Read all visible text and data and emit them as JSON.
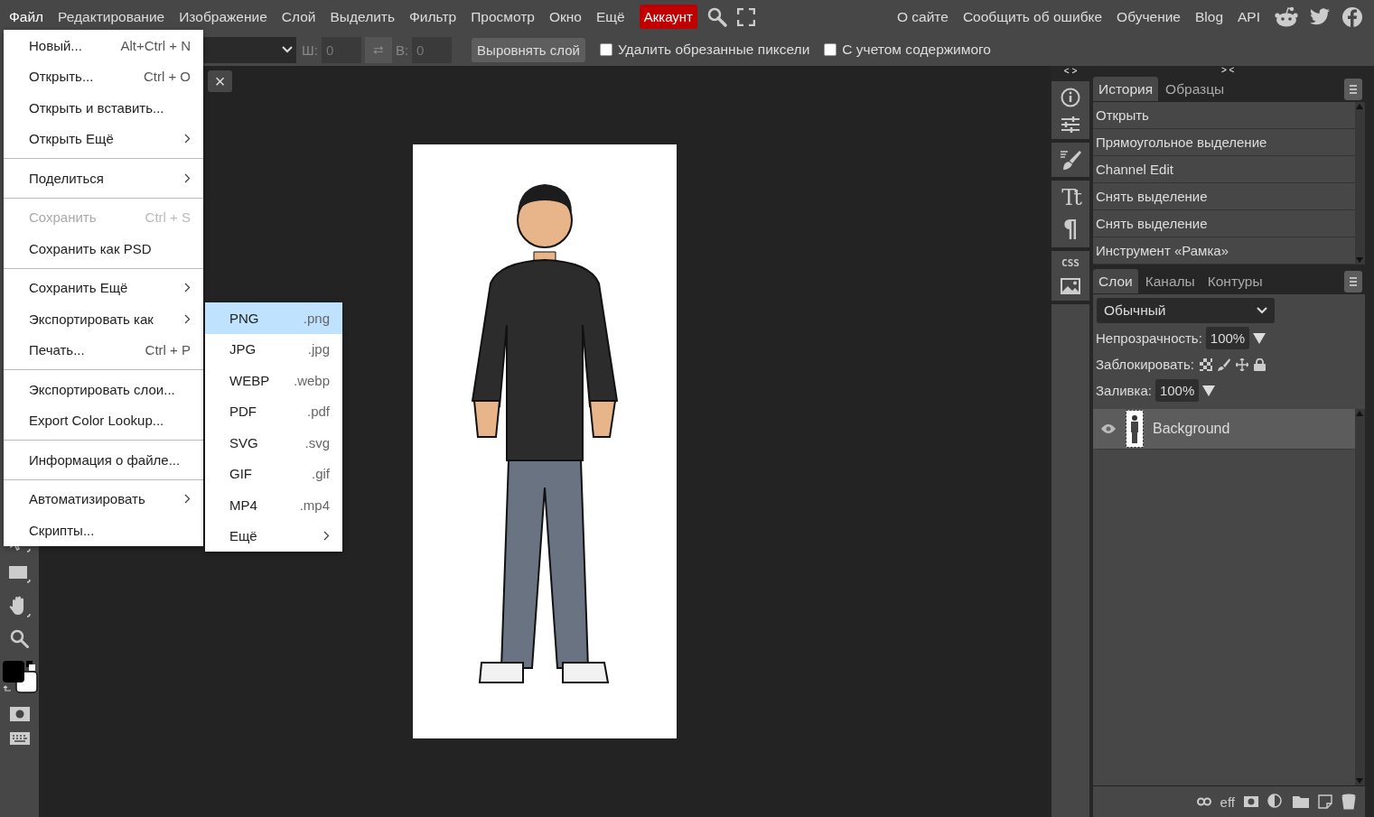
{
  "menubar": {
    "menus": [
      {
        "label": "Файл",
        "selected": true
      },
      {
        "label": "Редактирование",
        "selected": false
      },
      {
        "label": "Изображение",
        "selected": false
      },
      {
        "label": "Слой",
        "selected": false
      },
      {
        "label": "Выделить",
        "selected": false
      },
      {
        "label": "Фильтр",
        "selected": false
      },
      {
        "label": "Просмотр",
        "selected": false
      },
      {
        "label": "Окно",
        "selected": false
      },
      {
        "label": "Ещё",
        "selected": false
      }
    ],
    "account": "Аккаунт",
    "links": [
      "О сайте",
      "Сообщить об ошибке",
      "Обучение",
      "Blog",
      "API"
    ]
  },
  "options_bar": {
    "width_label": "Ш:",
    "width_value": "0",
    "height_label": "В:",
    "height_value": "0",
    "swap": "⇄",
    "align_button": "Выровнять слой",
    "checkboxes": [
      {
        "label": "Удалить обрезанные пиксели",
        "checked": false
      },
      {
        "label": "С учетом содержимого",
        "checked": false
      }
    ]
  },
  "document_tab": {
    "close": "×"
  },
  "file_menu": {
    "groups": [
      [
        {
          "label": "Новый...",
          "shortcut": "Alt+Ctrl + N",
          "submenu": false,
          "disabled": false
        },
        {
          "label": "Открыть...",
          "shortcut": "Ctrl + O",
          "submenu": false,
          "disabled": false
        },
        {
          "label": "Открыть и вставить...",
          "submenu": false,
          "disabled": false
        },
        {
          "label": "Открыть Ещё",
          "submenu": true,
          "disabled": false
        }
      ],
      [
        {
          "label": "Поделиться",
          "submenu": true,
          "disabled": false
        }
      ],
      [
        {
          "label": "Сохранить",
          "shortcut": "Ctrl + S",
          "submenu": false,
          "disabled": true
        },
        {
          "label": "Сохранить как PSD",
          "submenu": false,
          "disabled": false
        }
      ],
      [
        {
          "label": "Сохранить Ещё",
          "submenu": true,
          "disabled": false
        },
        {
          "label": "Экспортировать как",
          "submenu": true,
          "disabled": false
        },
        {
          "label": "Печать...",
          "shortcut": "Ctrl + P",
          "submenu": false,
          "disabled": false
        }
      ],
      [
        {
          "label": "Экспортировать слои...",
          "submenu": false,
          "disabled": false
        },
        {
          "label": "Export Color Lookup...",
          "submenu": false,
          "disabled": false
        }
      ],
      [
        {
          "label": "Информация о файле...",
          "submenu": false,
          "disabled": false
        }
      ],
      [
        {
          "label": "Автоматизировать",
          "submenu": true,
          "disabled": false
        },
        {
          "label": "Скрипты...",
          "submenu": false,
          "disabled": false
        }
      ]
    ]
  },
  "export_submenu": {
    "items": [
      {
        "label": "PNG",
        "extension": ".png",
        "selected": true,
        "submenu": false
      },
      {
        "label": "JPG",
        "extension": ".jpg",
        "selected": false,
        "submenu": false
      },
      {
        "label": "WEBP",
        "extension": ".webp",
        "selected": false,
        "submenu": false
      },
      {
        "label": "PDF",
        "extension": ".pdf",
        "selected": false,
        "submenu": false
      },
      {
        "label": "SVG",
        "extension": ".svg",
        "selected": false,
        "submenu": false
      },
      {
        "label": "GIF",
        "extension": ".gif",
        "selected": false,
        "submenu": false
      },
      {
        "label": "MP4",
        "extension": ".mp4",
        "selected": false,
        "submenu": false
      },
      {
        "label": "Ещё",
        "selected": false,
        "submenu": true
      }
    ]
  },
  "side_column": {
    "expand": "< >",
    "text_glyph": "Tt",
    "paragraph_glyph": "¶",
    "css_label": "CSS"
  },
  "history_panel": {
    "collapse": "> <",
    "tabs": [
      {
        "label": "История",
        "selected": true
      },
      {
        "label": "Образцы",
        "selected": false
      }
    ],
    "items": [
      "Открыть",
      "Прямоугольное выделение",
      "Channel Edit",
      "Снять выделение",
      "Снять выделение",
      "Инструмент «Рамка»"
    ]
  },
  "layers_panel": {
    "tabs": [
      {
        "label": "Слои",
        "selected": true
      },
      {
        "label": "Каналы",
        "selected": false
      },
      {
        "label": "Контуры",
        "selected": false
      }
    ],
    "blend_mode": "Обычный",
    "opacity_label": "Непрозрачность:",
    "opacity": "100%",
    "lock_label": "Заблокировать:",
    "fill_label": "Заливка:",
    "fill": "100%",
    "layers": [
      {
        "name": "Background",
        "visible": true,
        "selected": true
      }
    ],
    "effects_label": "eff"
  }
}
